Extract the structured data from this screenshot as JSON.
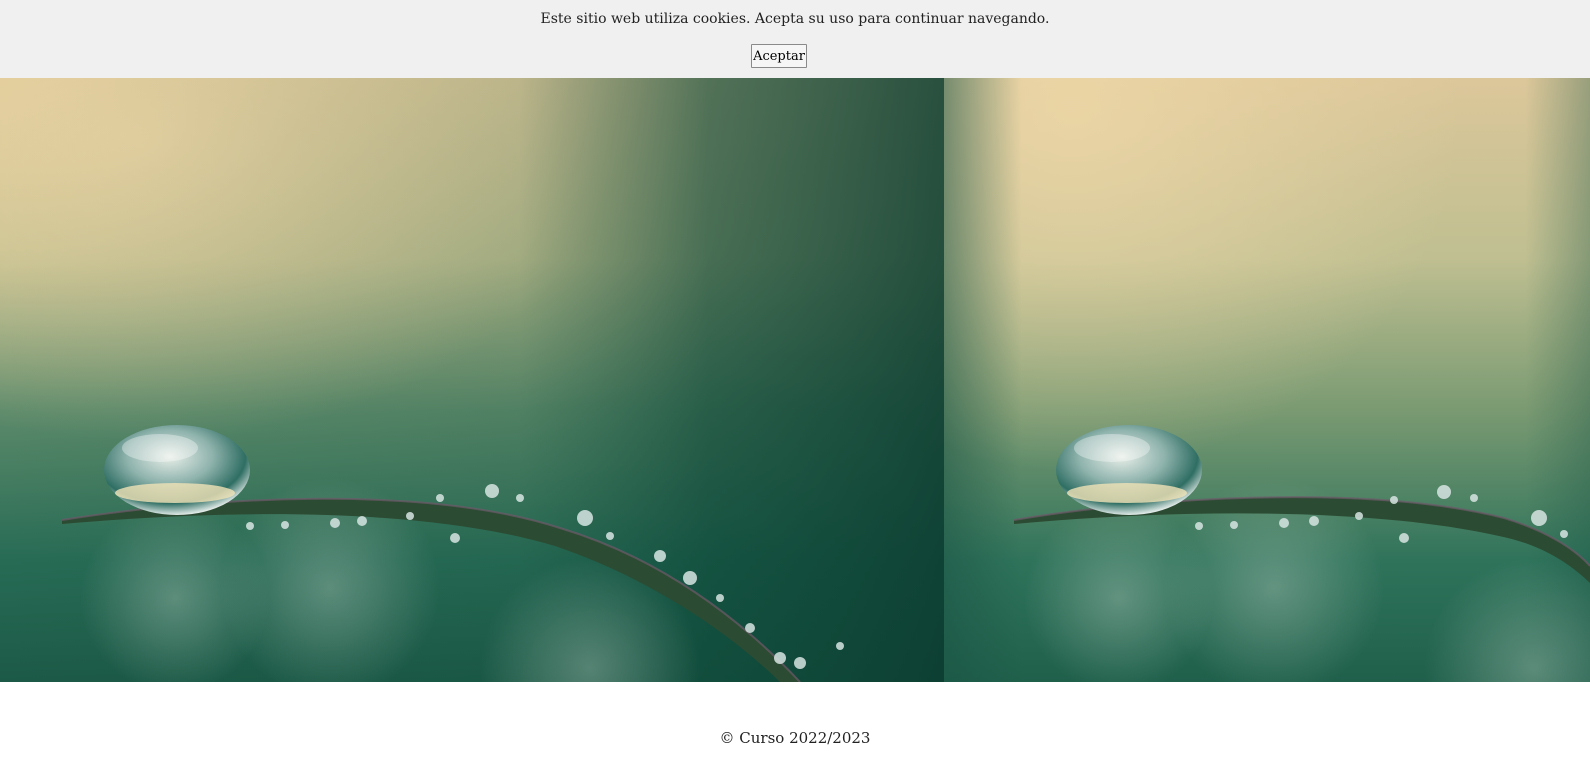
{
  "cookie_banner": {
    "message": "Este sitio web utiliza cookies. Acepta su uso para continuar navegando.",
    "accept_label": "Aceptar"
  },
  "gallery": {
    "images": [
      {
        "subject": "water-droplet-on-grass-blade"
      },
      {
        "subject": "water-droplet-on-grass-blade"
      }
    ]
  },
  "footer": {
    "copyright": "© Curso 2022/2023"
  },
  "colors": {
    "banner_background": "#f0f0f0",
    "page_background": "#ffffff",
    "sky_beige": "#d9c79a",
    "foliage_green": "#1f5e4a",
    "deep_green": "#0f3f33"
  }
}
